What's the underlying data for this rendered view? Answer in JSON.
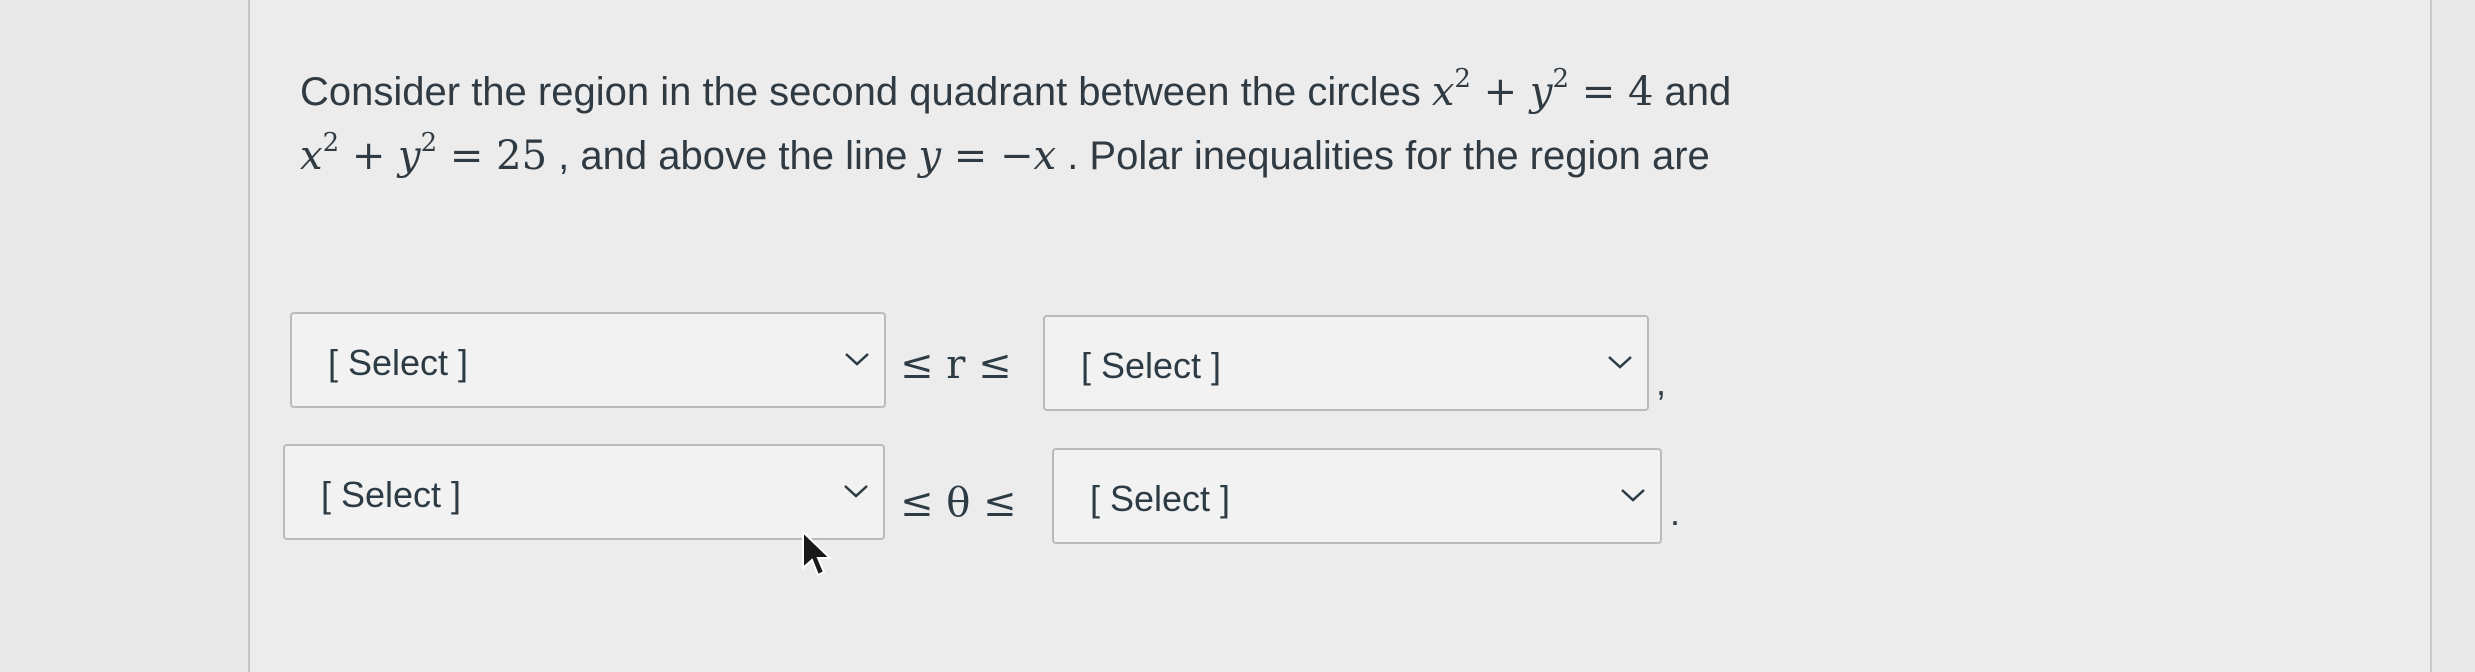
{
  "question": {
    "text_1": "Consider the region in the second quadrant between the circles ",
    "text_2": " and",
    "text_3": " , and above the line ",
    "text_4": " . Polar inequalities for the region are"
  },
  "r_row": {
    "lower_select": "[ Select ]",
    "relation": "≤ r ≤",
    "upper_select": "[ Select ]",
    "trailing": ","
  },
  "theta_row": {
    "lower_select": "[ Select ]",
    "relation": "≤ θ ≤",
    "upper_select": "[ Select ]",
    "trailing": "."
  },
  "icons": {
    "dropdown": "chevron-down-icon",
    "cursor": "mouse-pointer-icon"
  }
}
